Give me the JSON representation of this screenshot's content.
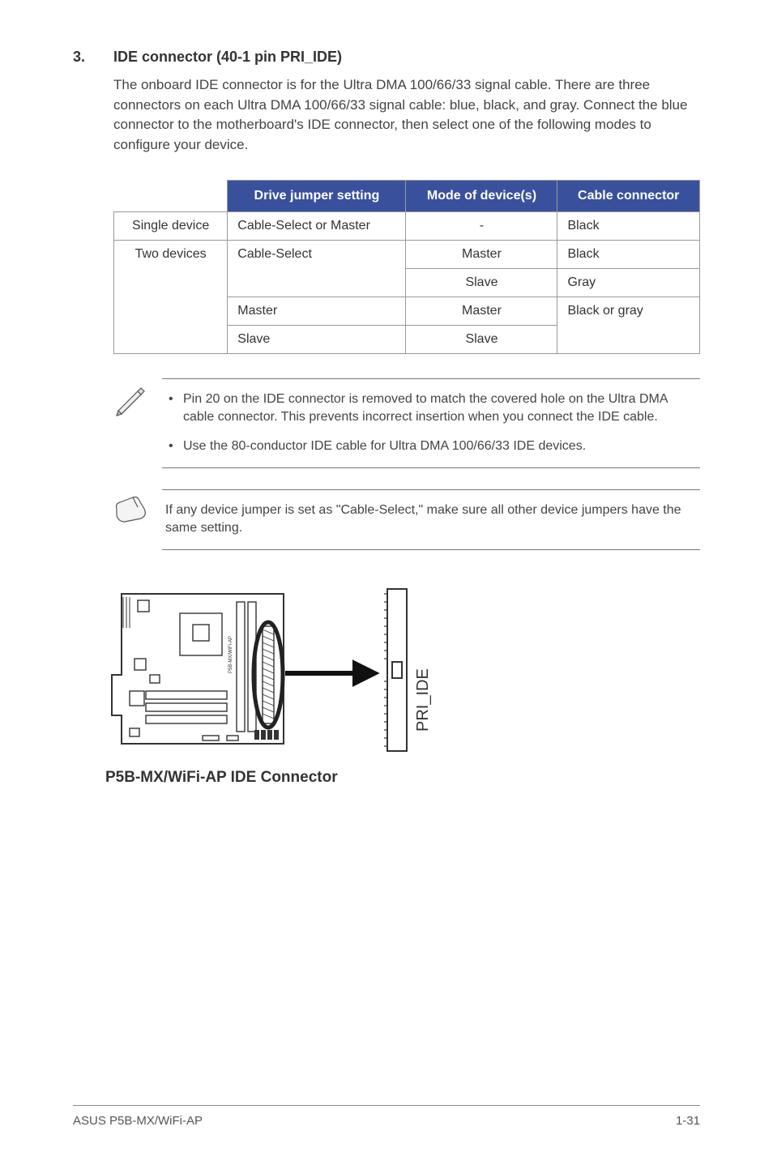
{
  "section": {
    "number": "3.",
    "title": "IDE connector (40-1 pin PRI_IDE)",
    "body": "The onboard IDE connector is for the Ultra DMA 100/66/33 signal cable. There are three connectors on each Ultra DMA 100/66/33 signal cable: blue, black, and gray. Connect the blue connector to the motherboard's IDE connector, then select one of the following modes to configure your device."
  },
  "table": {
    "headers": {
      "blank": "",
      "col1": "Drive jumper setting",
      "col2": "Mode of device(s)",
      "col3": "Cable connector"
    },
    "rows": {
      "r1_label": "Single device",
      "r1_setting": "Cable-Select or Master",
      "r1_mode": "-",
      "r1_cable": "Black",
      "r2_label": "Two devices",
      "r2_setting": "Cable-Select",
      "r2_mode": "Master",
      "r2_cable": "Black",
      "r3_mode": "Slave",
      "r3_cable": "Gray",
      "r4_setting": "Master",
      "r4_mode": "Master",
      "r4_cable": "Black or gray",
      "r5_setting": "Slave",
      "r5_mode": "Slave"
    }
  },
  "note1": {
    "bullet1": "Pin 20 on the IDE connector is removed to match the covered hole on the Ultra DMA cable connector. This prevents incorrect insertion when you connect the IDE cable.",
    "bullet2": "Use the 80-conductor IDE cable for Ultra DMA 100/66/33 IDE devices."
  },
  "note2": {
    "text": "If any device jumper is set as \"Cable-Select,\" make sure all other device jumpers have the same setting."
  },
  "diagram": {
    "caption": "P5B-MX/WiFi-AP IDE Connector",
    "connector_label": "PRI_IDE",
    "board_label": "P5B-MX/WiFi-AP"
  },
  "footer": {
    "left": "ASUS P5B-MX/WiFi-AP",
    "right": "1-31"
  }
}
